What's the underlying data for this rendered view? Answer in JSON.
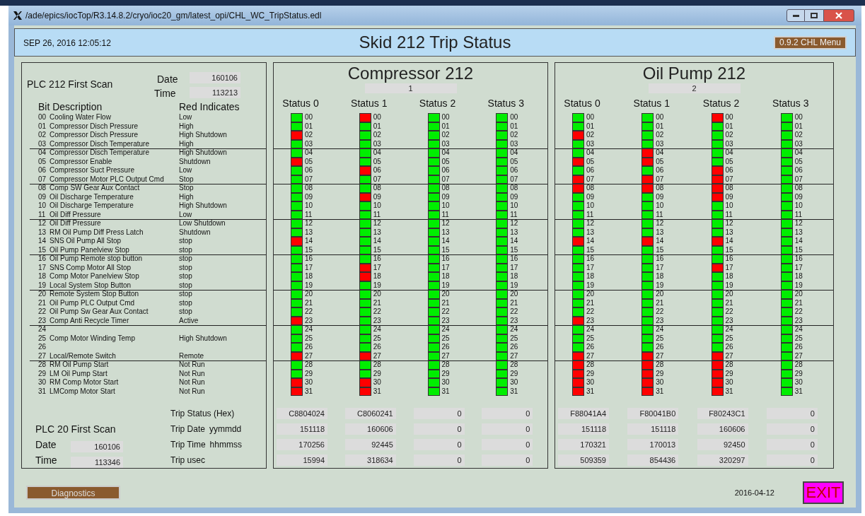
{
  "window": {
    "title": "/ade/epics/iocTop/R3.14.8.2/cryo/ioc20_gm/latest_opi/CHL_WC_TripStatus.edl"
  },
  "header": {
    "datetime": "SEP 26, 2016 12:05:12",
    "title": "Skid 212 Trip Status",
    "menu_button": "0.9.2 CHL Menu"
  },
  "plc212": {
    "title": "PLC 212 First Scan",
    "date_label": "Date",
    "date": "160106",
    "time_label": "Time",
    "time": "113213"
  },
  "bit_table": {
    "columns": [
      "Bit Description",
      "Red Indicates"
    ],
    "rows": [
      {
        "num": "00",
        "description": "Cooling Water Flow",
        "red_indicates": "Low"
      },
      {
        "num": "01",
        "description": "Compressor Disch Pressure",
        "red_indicates": "High"
      },
      {
        "num": "02",
        "description": "Compressor Disch Pressure",
        "red_indicates": "High Shutdown"
      },
      {
        "num": "03",
        "description": "Compressor Disch Temperature",
        "red_indicates": "High"
      },
      {
        "num": "04",
        "description": "Compressor Disch Temperature",
        "red_indicates": "High Shutdown"
      },
      {
        "num": "05",
        "description": "Compressor Enable",
        "red_indicates": "Shutdown"
      },
      {
        "num": "06",
        "description": "Compressor Suct Pressure",
        "red_indicates": "Low"
      },
      {
        "num": "07",
        "description": "Compressor Motor PLC Output Cmd",
        "red_indicates": "Stop"
      },
      {
        "num": "08",
        "description": "Comp SW Gear Aux Contact",
        "red_indicates": "Stop"
      },
      {
        "num": "09",
        "description": "Oil Discharge Temperature",
        "red_indicates": "High"
      },
      {
        "num": "10",
        "description": "Oil Discharge Temperature",
        "red_indicates": "High Shutdown"
      },
      {
        "num": "11",
        "description": "Oil Diff Pressure",
        "red_indicates": "Low"
      },
      {
        "num": "12",
        "description": "Oil Diff Pressure",
        "red_indicates": "Low Shutdown"
      },
      {
        "num": "13",
        "description": "RM Oil Pump Diff Press Latch",
        "red_indicates": "Shutdown"
      },
      {
        "num": "14",
        "description": "SNS Oil Pump All Stop",
        "red_indicates": "stop"
      },
      {
        "num": "15",
        "description": "Oil Pump Panelview Stop",
        "red_indicates": "stop"
      },
      {
        "num": "16",
        "description": "Oil Pump Remote stop button",
        "red_indicates": "stop"
      },
      {
        "num": "17",
        "description": "SNS Comp Motor All Stop",
        "red_indicates": "stop"
      },
      {
        "num": "18",
        "description": "Comp Motor Panelview Stop",
        "red_indicates": "stop"
      },
      {
        "num": "19",
        "description": "Local System Stop Button",
        "red_indicates": "stop"
      },
      {
        "num": "20",
        "description": "Remote System Stop Button",
        "red_indicates": "stop"
      },
      {
        "num": "21",
        "description": "Oil Pump PLC Output Cmd",
        "red_indicates": "stop"
      },
      {
        "num": "22",
        "description": "Oil Pump Sw Gear Aux Contact",
        "red_indicates": "stop"
      },
      {
        "num": "23",
        "description": "Comp Anti Recycle Timer",
        "red_indicates": "Active"
      },
      {
        "num": "24"
      },
      {
        "num": "25",
        "description": "Comp Motor Winding Temp",
        "red_indicates": "High Shutdown"
      },
      {
        "num": "26"
      },
      {
        "num": "27",
        "description": "Local/Remote Switch",
        "red_indicates": "Remote"
      },
      {
        "num": "28",
        "description": "RM Oil Pump Start",
        "red_indicates": "Not Run"
      },
      {
        "num": "29",
        "description": "LM Oil Pump Start",
        "red_indicates": "Not Run"
      },
      {
        "num": "30",
        "description": "RM Comp Motor Start",
        "red_indicates": "Not Run"
      },
      {
        "num": "31",
        "description": "LMComp Motor Start",
        "red_indicates": "Not Run"
      }
    ]
  },
  "trip_labels": [
    {
      "label": "Trip Status (Hex)"
    },
    {
      "label": "Trip Date",
      "unit": "yymmdd"
    },
    {
      "label": "Trip Time",
      "unit": "hhmmss"
    },
    {
      "label": "Trip usec"
    }
  ],
  "plc20": {
    "title": "PLC 20 First Scan",
    "date_label": "Date",
    "date": "160106",
    "time_label": "Time",
    "time": "113346"
  },
  "units": [
    {
      "title": "Compressor 212",
      "counter": "1",
      "statuses": [
        {
          "heading": "Status 0",
          "trip_values": [
            "C8804024",
            "151118",
            "170256",
            "15994"
          ],
          "bits": [
            {
              "n": "00",
              "red": false
            },
            {
              "n": "01",
              "red": false
            },
            {
              "n": "02",
              "red": true
            },
            {
              "n": "03",
              "red": false
            },
            {
              "n": "04",
              "red": false
            },
            {
              "n": "05",
              "red": true
            },
            {
              "n": "06",
              "red": false
            },
            {
              "n": "07",
              "red": false
            },
            {
              "n": "08",
              "red": false
            },
            {
              "n": "09",
              "red": false
            },
            {
              "n": "10",
              "red": false
            },
            {
              "n": "11",
              "red": false
            },
            {
              "n": "12",
              "red": false
            },
            {
              "n": "13",
              "red": false
            },
            {
              "n": "14",
              "red": true
            },
            {
              "n": "15",
              "red": false
            },
            {
              "n": "16",
              "red": false
            },
            {
              "n": "17",
              "red": false
            },
            {
              "n": "18",
              "red": false
            },
            {
              "n": "19",
              "red": false
            },
            {
              "n": "20",
              "red": false
            },
            {
              "n": "21",
              "red": false
            },
            {
              "n": "22",
              "red": false
            },
            {
              "n": "23",
              "red": true
            },
            {
              "n": "24",
              "red": false
            },
            {
              "n": "25",
              "red": false
            },
            {
              "n": "26",
              "red": false
            },
            {
              "n": "27",
              "red": true
            },
            {
              "n": "28",
              "red": false
            },
            {
              "n": "29",
              "red": false
            },
            {
              "n": "30",
              "red": true
            },
            {
              "n": "31",
              "red": true
            }
          ]
        },
        {
          "heading": "Status 1",
          "trip_values": [
            "C8060241",
            "160606",
            "92445",
            "318634"
          ],
          "bits": [
            {
              "n": "00",
              "red": true
            },
            {
              "n": "01",
              "red": false
            },
            {
              "n": "02",
              "red": false
            },
            {
              "n": "03",
              "red": false
            },
            {
              "n": "04",
              "red": false
            },
            {
              "n": "05",
              "red": false
            },
            {
              "n": "06",
              "red": true
            },
            {
              "n": "07",
              "red": false
            },
            {
              "n": "08",
              "red": false
            },
            {
              "n": "09",
              "red": true
            },
            {
              "n": "10",
              "red": false
            },
            {
              "n": "11",
              "red": false
            },
            {
              "n": "12",
              "red": false
            },
            {
              "n": "13",
              "red": false
            },
            {
              "n": "14",
              "red": false
            },
            {
              "n": "15",
              "red": false
            },
            {
              "n": "16",
              "red": false
            },
            {
              "n": "17",
              "red": true
            },
            {
              "n": "18",
              "red": true
            },
            {
              "n": "19",
              "red": false
            },
            {
              "n": "20",
              "red": false
            },
            {
              "n": "21",
              "red": false
            },
            {
              "n": "22",
              "red": false
            },
            {
              "n": "23",
              "red": false
            },
            {
              "n": "24",
              "red": false
            },
            {
              "n": "25",
              "red": false
            },
            {
              "n": "26",
              "red": false
            },
            {
              "n": "27",
              "red": true
            },
            {
              "n": "28",
              "red": false
            },
            {
              "n": "29",
              "red": false
            },
            {
              "n": "30",
              "red": true
            },
            {
              "n": "31",
              "red": true
            }
          ]
        },
        {
          "heading": "Status 2",
          "trip_values": [
            "0",
            "0",
            "0",
            "0"
          ],
          "bits": [
            {
              "n": "00",
              "red": false
            },
            {
              "n": "01",
              "red": false
            },
            {
              "n": "02",
              "red": false
            },
            {
              "n": "03",
              "red": false
            },
            {
              "n": "04",
              "red": false
            },
            {
              "n": "05",
              "red": false
            },
            {
              "n": "06",
              "red": false
            },
            {
              "n": "07",
              "red": false
            },
            {
              "n": "08",
              "red": false
            },
            {
              "n": "09",
              "red": false
            },
            {
              "n": "10",
              "red": false
            },
            {
              "n": "11",
              "red": false
            },
            {
              "n": "12",
              "red": false
            },
            {
              "n": "13",
              "red": false
            },
            {
              "n": "14",
              "red": false
            },
            {
              "n": "15",
              "red": false
            },
            {
              "n": "16",
              "red": false
            },
            {
              "n": "17",
              "red": false
            },
            {
              "n": "18",
              "red": false
            },
            {
              "n": "19",
              "red": false
            },
            {
              "n": "20",
              "red": false
            },
            {
              "n": "21",
              "red": false
            },
            {
              "n": "22",
              "red": false
            },
            {
              "n": "23",
              "red": false
            },
            {
              "n": "24",
              "red": false
            },
            {
              "n": "25",
              "red": false
            },
            {
              "n": "26",
              "red": false
            },
            {
              "n": "27",
              "red": false
            },
            {
              "n": "28",
              "red": false
            },
            {
              "n": "29",
              "red": false
            },
            {
              "n": "30",
              "red": false
            },
            {
              "n": "31",
              "red": false
            }
          ]
        },
        {
          "heading": "Status 3",
          "trip_values": [
            "0",
            "0",
            "0",
            "0"
          ],
          "bits": [
            {
              "n": "00",
              "red": false
            },
            {
              "n": "01",
              "red": false
            },
            {
              "n": "02",
              "red": false
            },
            {
              "n": "03",
              "red": false
            },
            {
              "n": "04",
              "red": false
            },
            {
              "n": "05",
              "red": false
            },
            {
              "n": "06",
              "red": false
            },
            {
              "n": "07",
              "red": false
            },
            {
              "n": "08",
              "red": false
            },
            {
              "n": "09",
              "red": false
            },
            {
              "n": "10",
              "red": false
            },
            {
              "n": "11",
              "red": false
            },
            {
              "n": "12",
              "red": false
            },
            {
              "n": "13",
              "red": false
            },
            {
              "n": "14",
              "red": false
            },
            {
              "n": "15",
              "red": false
            },
            {
              "n": "16",
              "red": false
            },
            {
              "n": "17",
              "red": false
            },
            {
              "n": "18",
              "red": false
            },
            {
              "n": "19",
              "red": false
            },
            {
              "n": "20",
              "red": false
            },
            {
              "n": "21",
              "red": false
            },
            {
              "n": "22",
              "red": false
            },
            {
              "n": "23",
              "red": false
            },
            {
              "n": "24",
              "red": false
            },
            {
              "n": "25",
              "red": false
            },
            {
              "n": "26",
              "red": false
            },
            {
              "n": "27",
              "red": false
            },
            {
              "n": "28",
              "red": false
            },
            {
              "n": "29",
              "red": false
            },
            {
              "n": "30",
              "red": false
            },
            {
              "n": "31",
              "red": false
            }
          ]
        }
      ]
    },
    {
      "title": "Oil Pump 212",
      "counter": "2",
      "statuses": [
        {
          "heading": "Status 0",
          "trip_values": [
            "F88041A4",
            "151118",
            "170321",
            "509359"
          ],
          "bits": [
            {
              "n": "00",
              "red": false
            },
            {
              "n": "01",
              "red": false
            },
            {
              "n": "02",
              "red": true
            },
            {
              "n": "03",
              "red": false
            },
            {
              "n": "04",
              "red": false
            },
            {
              "n": "05",
              "red": true
            },
            {
              "n": "06",
              "red": false
            },
            {
              "n": "07",
              "red": true
            },
            {
              "n": "08",
              "red": true
            },
            {
              "n": "09",
              "red": false
            },
            {
              "n": "10",
              "red": false
            },
            {
              "n": "11",
              "red": false
            },
            {
              "n": "12",
              "red": false
            },
            {
              "n": "13",
              "red": false
            },
            {
              "n": "14",
              "red": true
            },
            {
              "n": "15",
              "red": false
            },
            {
              "n": "16",
              "red": false
            },
            {
              "n": "17",
              "red": false
            },
            {
              "n": "18",
              "red": false
            },
            {
              "n": "19",
              "red": false
            },
            {
              "n": "20",
              "red": false
            },
            {
              "n": "21",
              "red": false
            },
            {
              "n": "22",
              "red": false
            },
            {
              "n": "23",
              "red": true
            },
            {
              "n": "24",
              "red": false
            },
            {
              "n": "25",
              "red": false
            },
            {
              "n": "26",
              "red": false
            },
            {
              "n": "27",
              "red": true
            },
            {
              "n": "28",
              "red": true
            },
            {
              "n": "29",
              "red": true
            },
            {
              "n": "30",
              "red": true
            },
            {
              "n": "31",
              "red": true
            }
          ]
        },
        {
          "heading": "Status 1",
          "trip_values": [
            "F80041B0",
            "151118",
            "170013",
            "854436"
          ],
          "bits": [
            {
              "n": "00",
              "red": false
            },
            {
              "n": "01",
              "red": false
            },
            {
              "n": "02",
              "red": false
            },
            {
              "n": "03",
              "red": false
            },
            {
              "n": "04",
              "red": true
            },
            {
              "n": "05",
              "red": true
            },
            {
              "n": "06",
              "red": false
            },
            {
              "n": "07",
              "red": true
            },
            {
              "n": "08",
              "red": true
            },
            {
              "n": "09",
              "red": false
            },
            {
              "n": "10",
              "red": false
            },
            {
              "n": "11",
              "red": false
            },
            {
              "n": "12",
              "red": false
            },
            {
              "n": "13",
              "red": false
            },
            {
              "n": "14",
              "red": true
            },
            {
              "n": "15",
              "red": false
            },
            {
              "n": "16",
              "red": false
            },
            {
              "n": "17",
              "red": false
            },
            {
              "n": "18",
              "red": false
            },
            {
              "n": "19",
              "red": false
            },
            {
              "n": "20",
              "red": false
            },
            {
              "n": "21",
              "red": false
            },
            {
              "n": "22",
              "red": false
            },
            {
              "n": "23",
              "red": false
            },
            {
              "n": "24",
              "red": false
            },
            {
              "n": "25",
              "red": false
            },
            {
              "n": "26",
              "red": false
            },
            {
              "n": "27",
              "red": true
            },
            {
              "n": "28",
              "red": true
            },
            {
              "n": "29",
              "red": true
            },
            {
              "n": "30",
              "red": true
            },
            {
              "n": "31",
              "red": true
            }
          ]
        },
        {
          "heading": "Status 2",
          "trip_values": [
            "F80243C1",
            "160606",
            "92450",
            "320297"
          ],
          "bits": [
            {
              "n": "00",
              "red": true
            },
            {
              "n": "01",
              "red": false
            },
            {
              "n": "02",
              "red": false
            },
            {
              "n": "03",
              "red": false
            },
            {
              "n": "04",
              "red": false
            },
            {
              "n": "05",
              "red": false
            },
            {
              "n": "06",
              "red": true
            },
            {
              "n": "07",
              "red": true
            },
            {
              "n": "08",
              "red": true
            },
            {
              "n": "09",
              "red": true
            },
            {
              "n": "10",
              "red": false
            },
            {
              "n": "11",
              "red": false
            },
            {
              "n": "12",
              "red": false
            },
            {
              "n": "13",
              "red": false
            },
            {
              "n": "14",
              "red": true
            },
            {
              "n": "15",
              "red": false
            },
            {
              "n": "16",
              "red": false
            },
            {
              "n": "17",
              "red": true
            },
            {
              "n": "18",
              "red": false
            },
            {
              "n": "19",
              "red": false
            },
            {
              "n": "20",
              "red": false
            },
            {
              "n": "21",
              "red": false
            },
            {
              "n": "22",
              "red": false
            },
            {
              "n": "23",
              "red": false
            },
            {
              "n": "24",
              "red": false
            },
            {
              "n": "25",
              "red": false
            },
            {
              "n": "26",
              "red": false
            },
            {
              "n": "27",
              "red": true
            },
            {
              "n": "28",
              "red": true
            },
            {
              "n": "29",
              "red": true
            },
            {
              "n": "30",
              "red": true
            },
            {
              "n": "31",
              "red": true
            }
          ]
        },
        {
          "heading": "Status 3",
          "trip_values": [
            "0",
            "0",
            "0",
            "0"
          ],
          "bits": [
            {
              "n": "00",
              "red": false
            },
            {
              "n": "01",
              "red": false
            },
            {
              "n": "02",
              "red": false
            },
            {
              "n": "03",
              "red": false
            },
            {
              "n": "04",
              "red": false
            },
            {
              "n": "05",
              "red": false
            },
            {
              "n": "06",
              "red": false
            },
            {
              "n": "07",
              "red": false
            },
            {
              "n": "08",
              "red": false
            },
            {
              "n": "09",
              "red": false
            },
            {
              "n": "10",
              "red": false
            },
            {
              "n": "11",
              "red": false
            },
            {
              "n": "12",
              "red": false
            },
            {
              "n": "13",
              "red": false
            },
            {
              "n": "14",
              "red": false
            },
            {
              "n": "15",
              "red": false
            },
            {
              "n": "16",
              "red": false
            },
            {
              "n": "17",
              "red": false
            },
            {
              "n": "18",
              "red": false
            },
            {
              "n": "19",
              "red": false
            },
            {
              "n": "20",
              "red": false
            },
            {
              "n": "21",
              "red": false
            },
            {
              "n": "22",
              "red": false
            },
            {
              "n": "23",
              "red": false
            },
            {
              "n": "24",
              "red": false
            },
            {
              "n": "25",
              "red": false
            },
            {
              "n": "26",
              "red": false
            },
            {
              "n": "27",
              "red": false
            },
            {
              "n": "28",
              "red": false
            },
            {
              "n": "29",
              "red": false
            },
            {
              "n": "30",
              "red": false
            },
            {
              "n": "31",
              "red": false
            }
          ]
        }
      ]
    }
  ],
  "footer": {
    "diagnostics_button": "Diagnostics",
    "date": "2016-04-12",
    "exit_button": "EXIT"
  }
}
